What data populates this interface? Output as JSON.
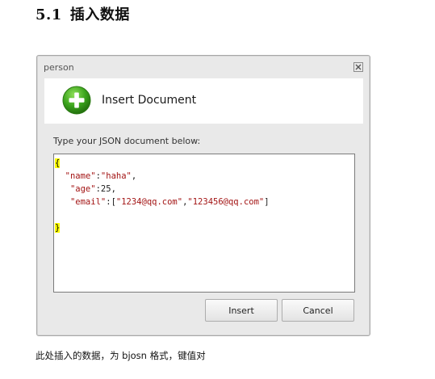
{
  "document": {
    "section_number": "5.1",
    "section_title": "插入数据",
    "caption": "此处插入的数据，为 bjosn 格式，键值对"
  },
  "dialog": {
    "title": "person",
    "header_title": "Insert Document",
    "prompt_label": "Type your JSON document below:",
    "icons": {
      "close": "close-icon",
      "add": "plus-icon"
    },
    "json_lines": {
      "open_brace": "{",
      "name_key": "\"name\"",
      "name_sep": ":",
      "name_value": "\"haha\"",
      "name_end": ",",
      "age_key": "\"age\"",
      "age_sep": ":",
      "age_value": "25",
      "age_end": ",",
      "email_key": "\"email\"",
      "email_sep": ":",
      "email_open": "[",
      "email_value1": "\"1234@qq.com\"",
      "email_comma": ",",
      "email_value2": "\"123456@qq.com\"",
      "email_close": "]",
      "close_brace": "}"
    },
    "buttons": {
      "insert_label": "Insert",
      "cancel_label": "Cancel"
    }
  },
  "colors": {
    "accent_green": "#3aa31c",
    "json_key_color": "#a31515",
    "highlight_yellow": "#ffff00"
  }
}
